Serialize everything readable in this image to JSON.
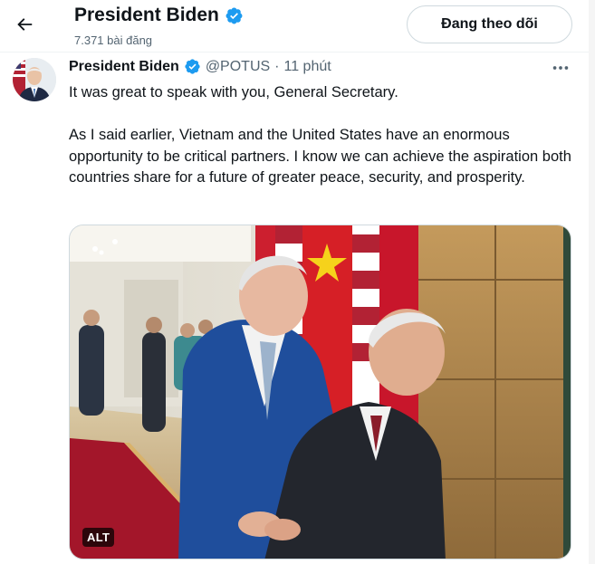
{
  "header": {
    "back_icon": "arrow-left-icon",
    "title": "President Biden",
    "post_count": "7.371 bài đăng",
    "follow_button": "Đang theo dõi",
    "verified_icon": "verified-badge-icon"
  },
  "tweet": {
    "author_name": "President Biden",
    "handle": "@POTUS",
    "separator": "·",
    "time": "11 phút",
    "more_icon": "more-horizontal-icon",
    "paragraphs": [
      "It was great to speak with you, General Secretary.",
      "As I said earlier, Vietnam and the United States have an enormous opportunity to be critical partners. I know we can achieve the aspiration both countries share for a future of greater peace, security, and prosperity."
    ],
    "media": {
      "alt_badge": "ALT"
    }
  },
  "colors": {
    "verified_blue": "#1d9bf0",
    "text_primary": "#0f1419",
    "text_secondary": "#536471",
    "border": "#cfd9de"
  }
}
